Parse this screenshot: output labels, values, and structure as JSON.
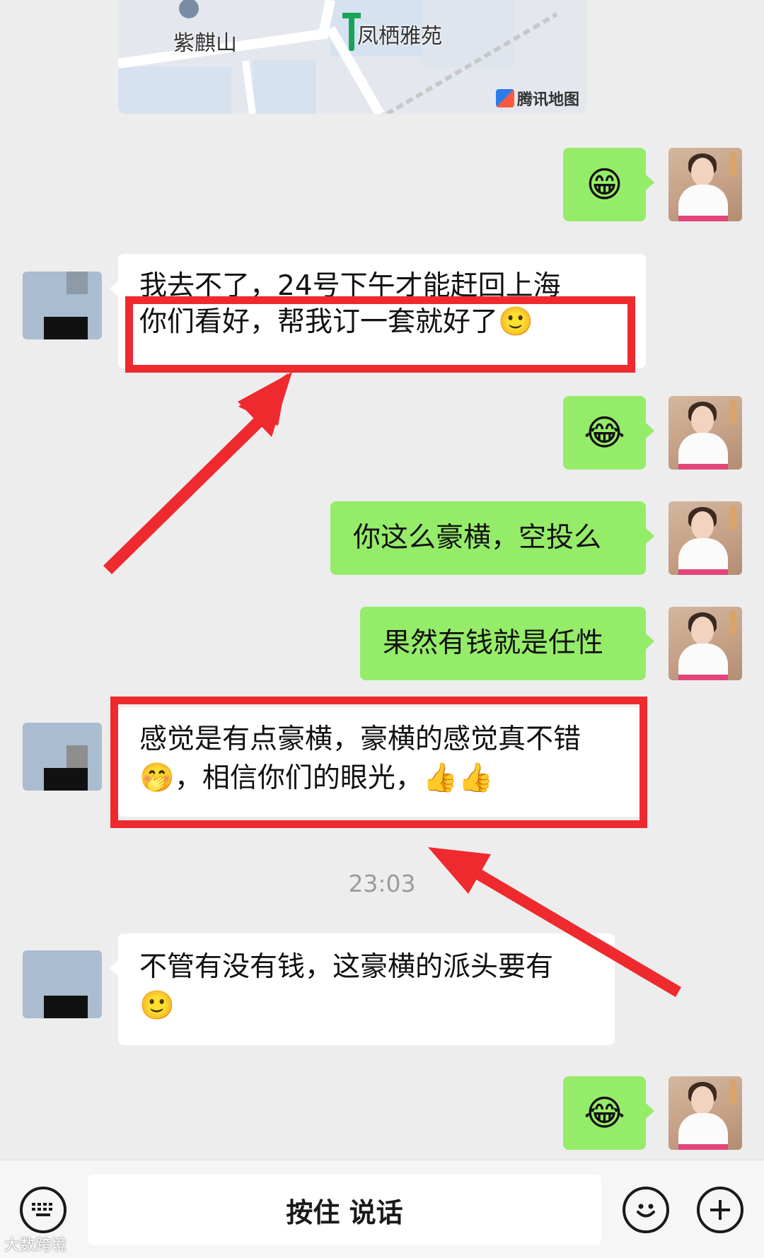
{
  "map": {
    "place_left": "紫麒山",
    "place_right": "凤栖雅苑",
    "brand": "腾讯地图"
  },
  "messages": {
    "m1_emoji": "😁",
    "m2_line1": "我去不了，24号下午才能赶回上海",
    "m2_line2": "你们看好，帮我订一套就好了",
    "m2_emoji": "🙂",
    "m3_emoji": "😂",
    "m4_text": "你这么豪横，空投么",
    "m5_text": "果然有钱就是任性",
    "m6_line1": "感觉是有点豪横，豪横的感觉真不错",
    "m6_line2": "，相信你们的眼光，",
    "m6_emoji_a": "🤭",
    "m6_emoji_b": "👍👍",
    "timestamp": "23:03",
    "m7_line1": "不管有没有钱，这豪横的派头要有",
    "m7_emoji": "🙂",
    "m8_emoji": "😂"
  },
  "input_bar": {
    "hold_to_talk": "按住 说话"
  },
  "watermark": "大数跨境",
  "colors": {
    "green_bubble": "#95ec69",
    "highlight_red": "#ef2a2f",
    "background": "#ededed"
  },
  "icons": [
    "keyboard-icon",
    "emoji-face-icon",
    "plus-icon",
    "map-pin-icon",
    "tencent-map-logo-icon"
  ]
}
